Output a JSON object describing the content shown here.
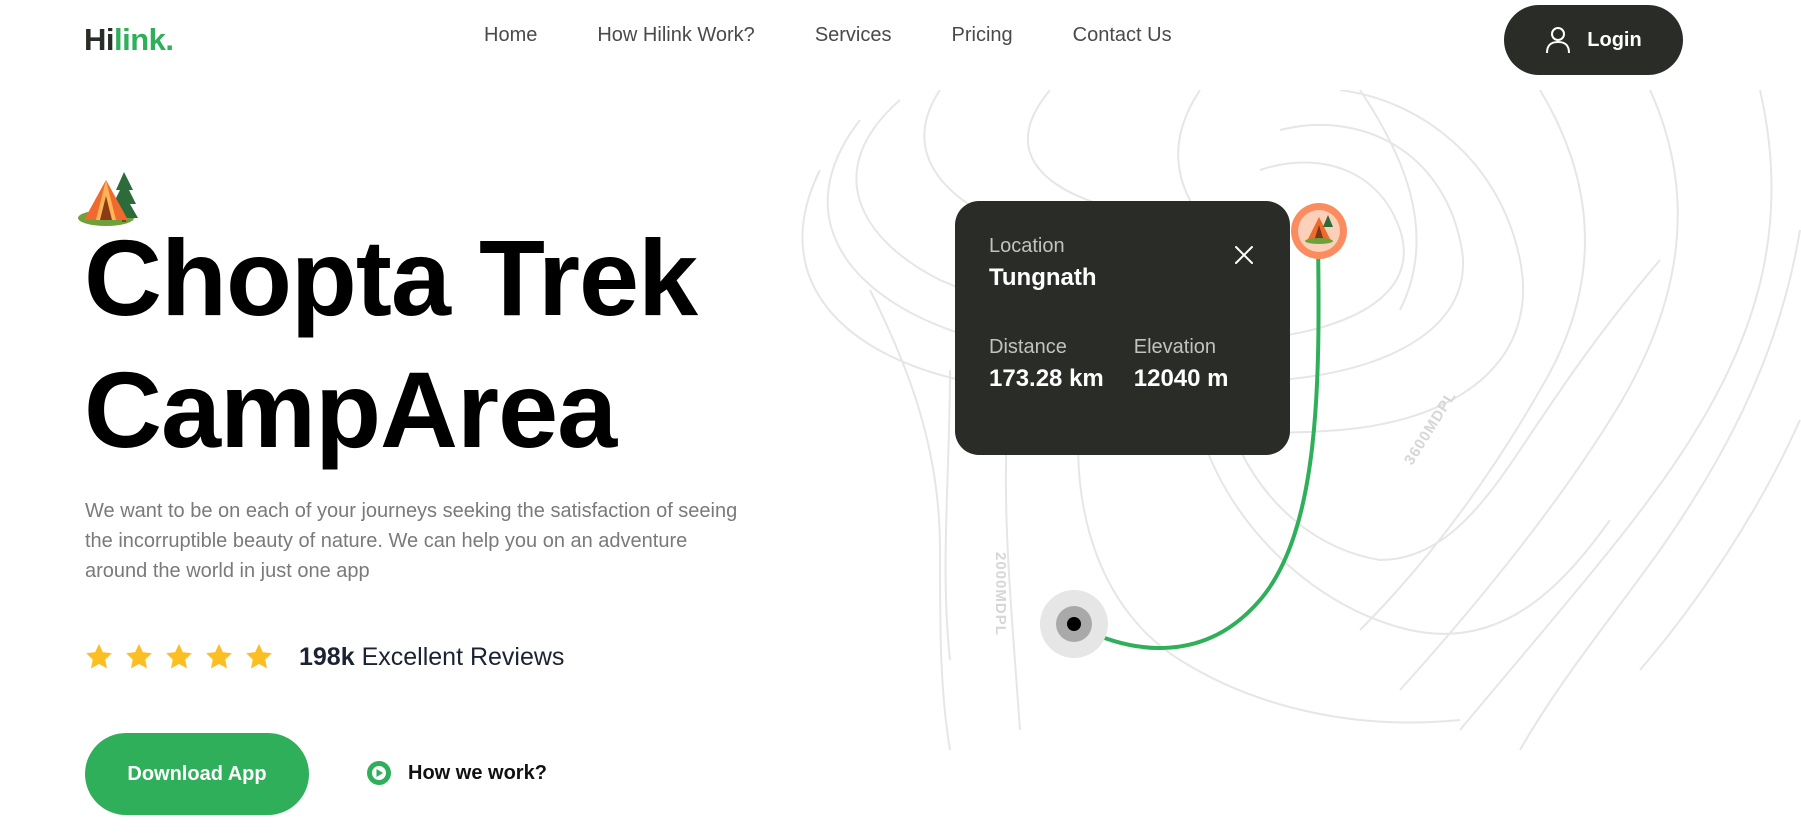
{
  "brand": {
    "name_part1": "Hi",
    "name_part2": "link.",
    "accent": "#30af5b",
    "dark": "#292c27"
  },
  "nav": {
    "items": [
      {
        "label": "Home"
      },
      {
        "label": "How Hilink Work?"
      },
      {
        "label": "Services"
      },
      {
        "label": "Pricing"
      },
      {
        "label": "Contact Us"
      }
    ],
    "login_label": "Login",
    "login_icon": "user-icon"
  },
  "hero": {
    "icon": "camp-icon",
    "title_line1": "Chopta Trek",
    "title_line2": "CampArea",
    "description": "We want to be on each of your journeys seeking the satisfaction of seeing the incorruptible beauty of nature. We can help you on an adventure around the world in just one app",
    "rating": {
      "stars": 5,
      "star_color": "#fbbf24",
      "count": "198k",
      "label": "Excellent Reviews"
    },
    "download_label": "Download App",
    "how_label": "How we work?"
  },
  "map": {
    "card": {
      "location_label": "Location",
      "location_value": "Tungnath",
      "distance_label": "Distance",
      "distance_value": "173.28 km",
      "elevation_label": "Elevation",
      "elevation_value": "12040 m"
    },
    "contour_label_1": "2000MDPL",
    "contour_label_2": "3600MDPL",
    "route_color": "#30af5b",
    "pin_color": "#fb8c5f"
  }
}
